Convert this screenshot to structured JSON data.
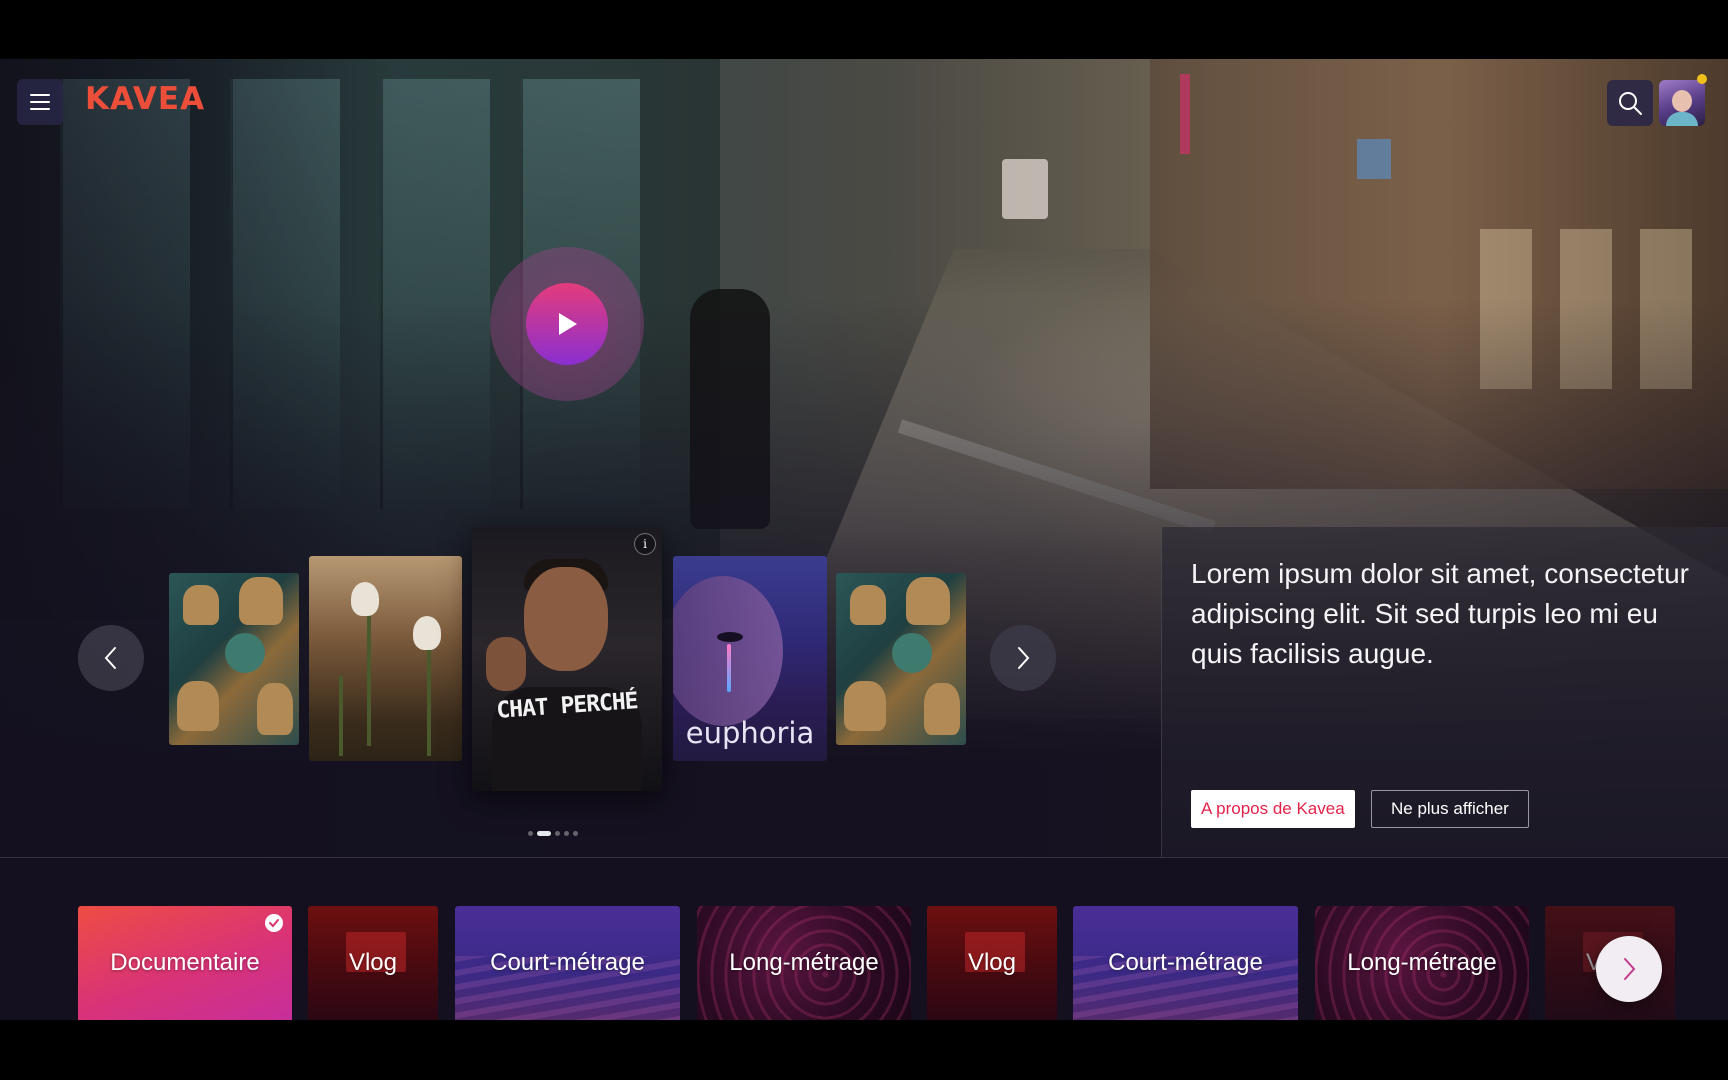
{
  "header": {
    "logo_text": "KAVEA",
    "menu_icon": "hamburger-icon",
    "search_icon": "search-icon"
  },
  "hero": {
    "play_icon": "play-icon",
    "info_icon_label": "i",
    "carousel": {
      "items": [
        {
          "name": "card-decor"
        },
        {
          "name": "card-snowdrops"
        },
        {
          "name": "card-chat-perche",
          "title_art": "CHAT PERCHÉ"
        },
        {
          "name": "card-euphoria",
          "title_art": "euphoria"
        },
        {
          "name": "card-decor-2"
        }
      ],
      "page_count": 5,
      "active_page": 2
    }
  },
  "info_panel": {
    "text": "Lorem ipsum dolor sit amet, consectetur adipiscing elit. Sit sed turpis leo mi eu quis facilisis augue.",
    "about_button": "A propos de Kavea",
    "hide_button": "Ne plus afficher"
  },
  "categories": [
    {
      "label": "Documentaire",
      "selected": true
    },
    {
      "label": "Vlog"
    },
    {
      "label": "Court-métrage"
    },
    {
      "label": "Long-métrage"
    },
    {
      "label": "Vlog"
    },
    {
      "label": "Court-métrage"
    },
    {
      "label": "Long-métrage"
    },
    {
      "label": "Vlog"
    }
  ],
  "colors": {
    "brand": "#ec4e3a",
    "accent": "#e2234b",
    "background": "#14101f"
  }
}
